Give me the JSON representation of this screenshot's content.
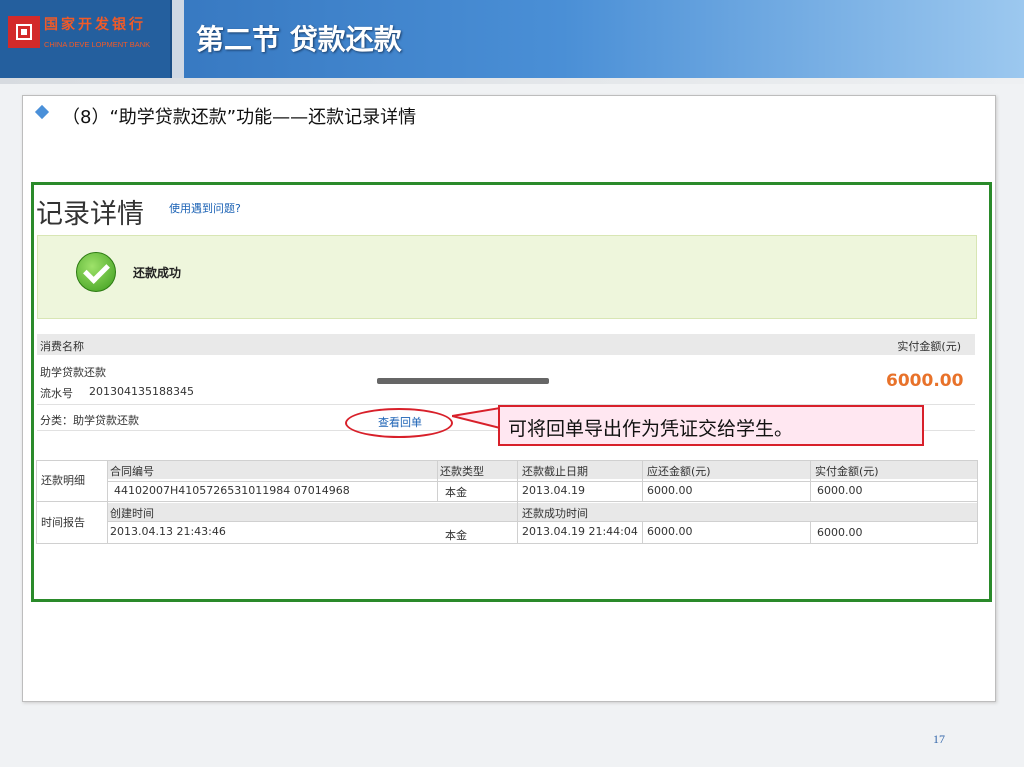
{
  "header": {
    "bank_cn": "国家开发银行",
    "bank_en": "CHINA DEVE LOPMENT BANK",
    "section_title": "第二节  贷款还款"
  },
  "subtitle": "（8）“助学贷款还款”功能——还款记录详情",
  "record": {
    "title": "记录详情",
    "help_link": "使用遇到问题?",
    "status": "还款成功",
    "table_header_left": "消费名称",
    "table_header_right": "实付金额(元)",
    "item_name": "助学贷款还款",
    "serial_label": "流水号",
    "serial_no": "201304135188345",
    "category": "分类：助学贷款还款",
    "amount": "6000.00",
    "view_receipt": "查看回单"
  },
  "callout": "可将回单导出作为凭证交给学生。",
  "details": {
    "row_label_1": "还款明细",
    "row_label_2": "时间报告",
    "headers": [
      "合同编号",
      "还款类型",
      "还款截止日期",
      "应还金额(元)",
      "实付金额(元)"
    ],
    "row1": [
      "44102007H4105726531011984 07014968",
      "本金",
      "2013.04.19",
      "6000.00",
      "6000.00"
    ],
    "time_headers": [
      "创建时间",
      "还款成功时间"
    ],
    "row2": [
      "2013.04.13 21:43:46",
      "本金",
      "2013.04.19 21:44:04",
      "6000.00",
      "6000.00"
    ]
  },
  "page_number": "17"
}
